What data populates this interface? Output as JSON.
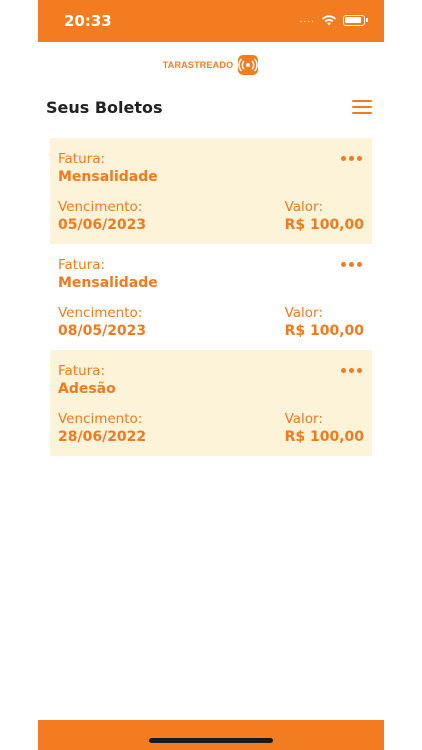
{
  "status": {
    "time": "20:33",
    "signal_dots": "...."
  },
  "brand": {
    "name": "TARASTREADO"
  },
  "header": {
    "title": "Seus Boletos",
    "menu_icon": "hamburger-icon"
  },
  "boletos": [
    {
      "fatura_label": "Fatura:",
      "fatura": "Mensalidade",
      "vencimento_label": "Vencimento:",
      "vencimento": "05/06/2023",
      "valor_label": "Valor:",
      "valor": "R$ 100,00"
    },
    {
      "fatura_label": "Fatura:",
      "fatura": "Mensalidade",
      "vencimento_label": "Vencimento:",
      "vencimento": "08/05/2023",
      "valor_label": "Valor:",
      "valor": "R$ 100,00"
    },
    {
      "fatura_label": "Fatura:",
      "fatura": "Adesão",
      "vencimento_label": "Vencimento:",
      "vencimento": "28/06/2022",
      "valor_label": "Valor:",
      "valor": "R$ 100,00"
    }
  ],
  "colors": {
    "accent": "#f37c21",
    "card_tint": "#fdf3d9",
    "text_dark": "#222222"
  }
}
